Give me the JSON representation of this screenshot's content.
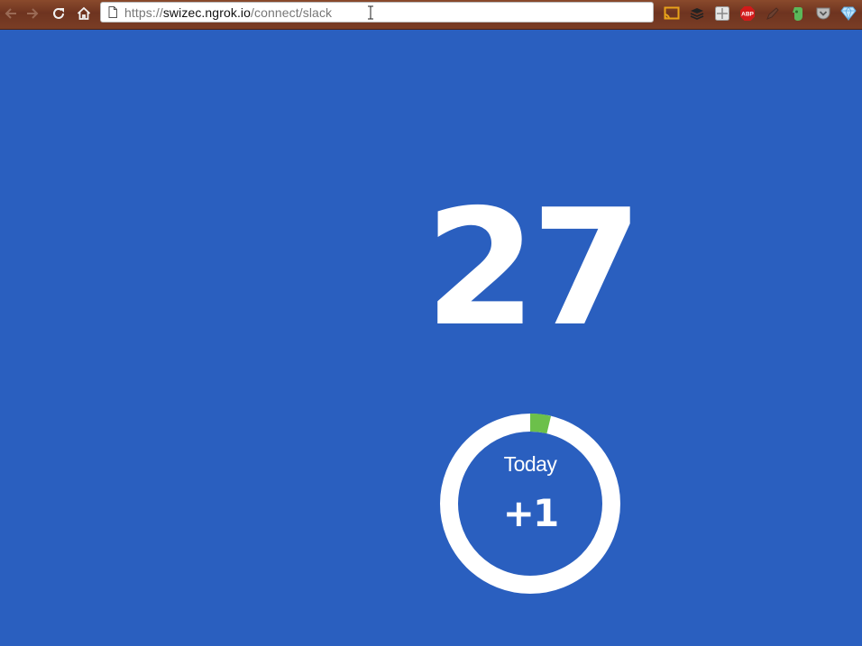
{
  "browser": {
    "url_host": "https://swizec.ngrok.io",
    "url_scheme": "https://",
    "url_domain": "swizec.ngrok.io",
    "url_path": "/connect/slack",
    "nav": [
      "back-icon",
      "forward-icon",
      "reload-icon",
      "home-icon"
    ],
    "extensions": [
      "cast-icon",
      "buffer-icon",
      "grid-extension-icon",
      "adblock-plus-icon",
      "pen-extension-icon",
      "evernote-icon",
      "pocket-icon",
      "gem-extension-icon"
    ],
    "adblock_label": "ABP"
  },
  "main": {
    "counter": "27",
    "today_label": "Today",
    "today_value": "+1",
    "today_progress_fraction": 0.037
  },
  "colors": {
    "background": "#2a5fbf",
    "ring": "#ffffff",
    "progress": "#6cc04a"
  }
}
